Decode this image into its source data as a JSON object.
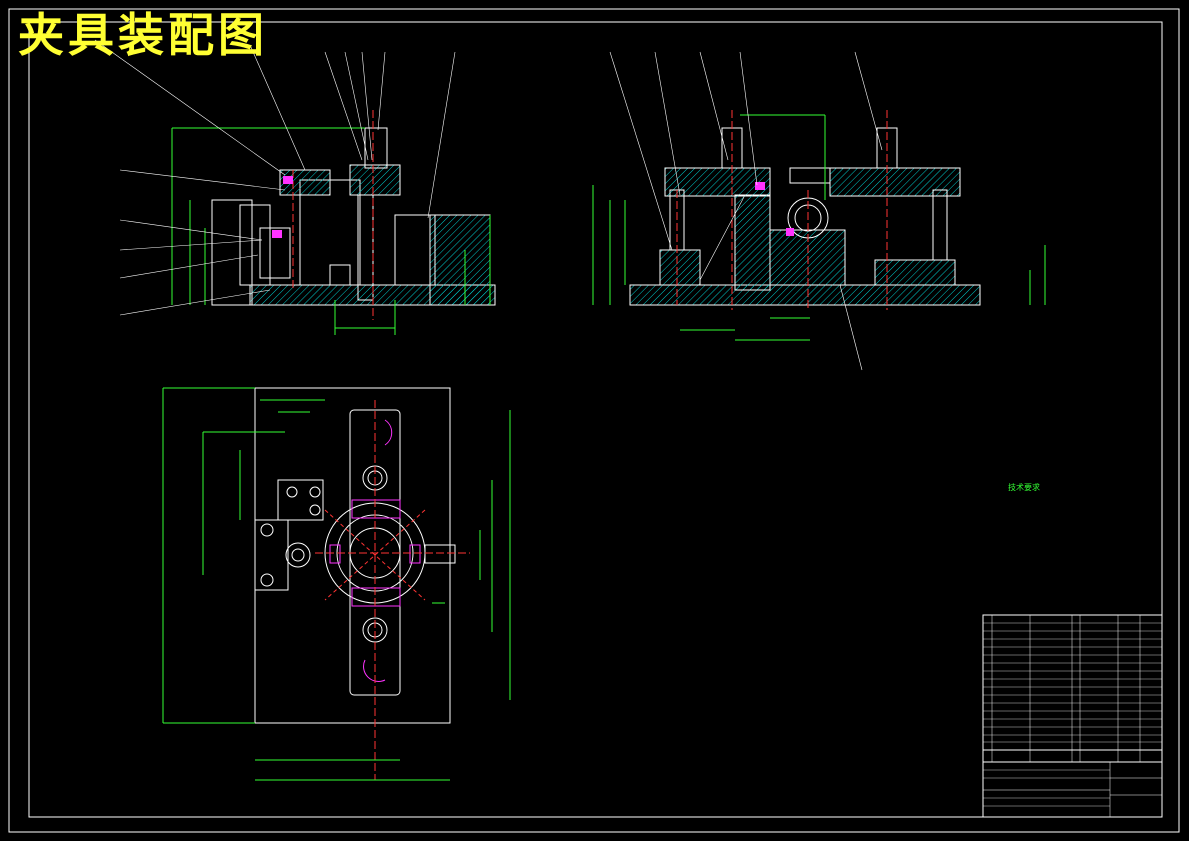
{
  "drawing": {
    "title": "夹具装配图"
  },
  "tech_requirements": {
    "heading": "技术要求"
  },
  "colors": {
    "background": "#000000",
    "outline": "#ffffff",
    "dimension": "#33ff33",
    "centerline": "#ff3333",
    "hatch": "#00cccc",
    "highlight": "#ff33ff",
    "title": "#ffff33"
  }
}
